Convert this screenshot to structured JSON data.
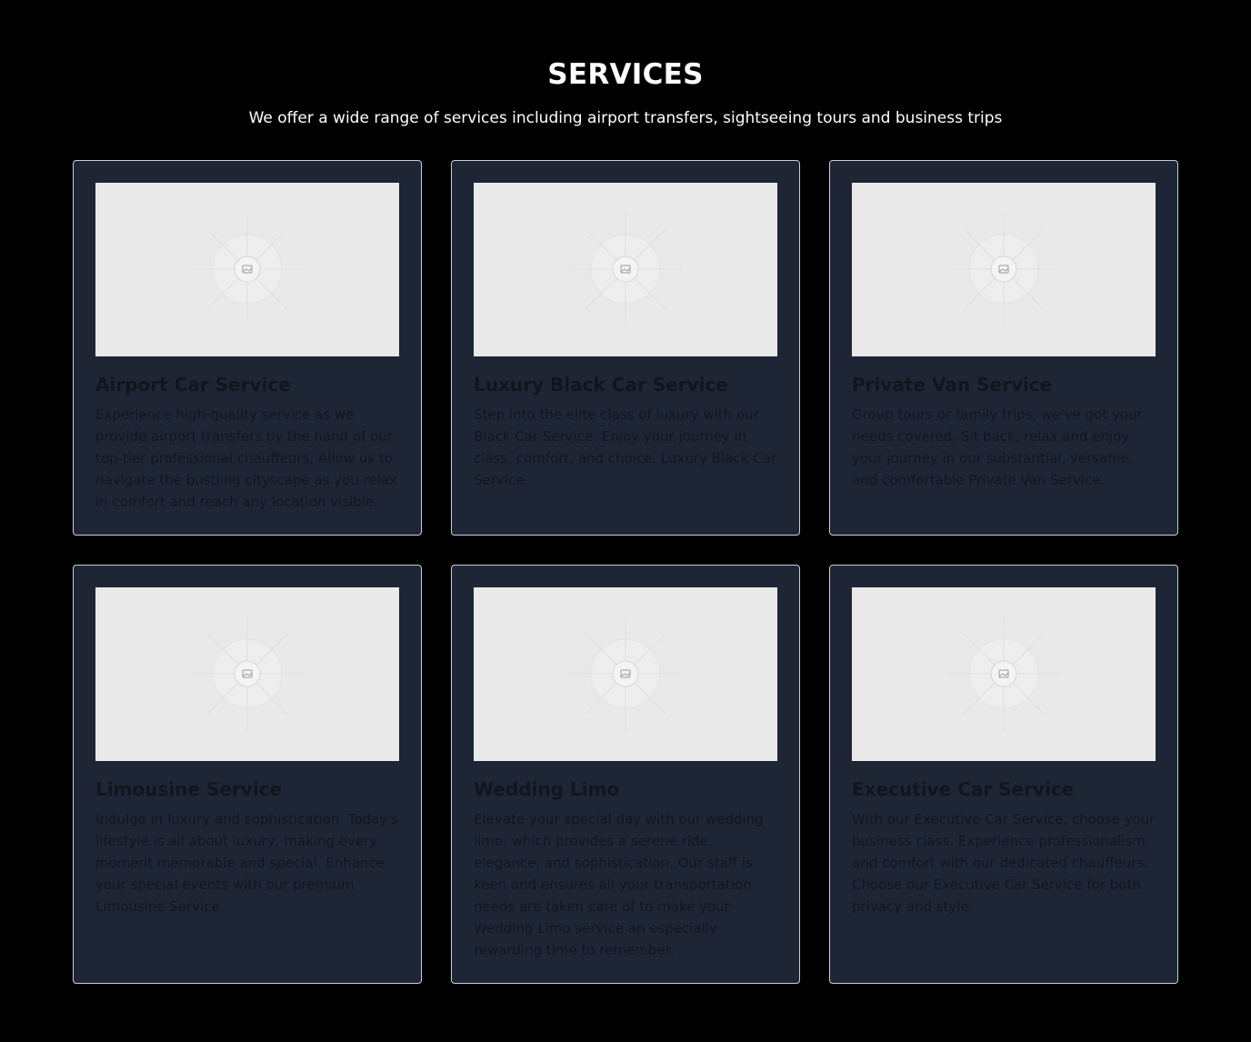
{
  "header": {
    "title": "SERVICES",
    "subtitle": "We offer a wide range of services including airport transfers, sightseeing tours and business trips"
  },
  "colors": {
    "page_background": "#000000",
    "card_background": "#1e2636",
    "card_border": "#c9ced8",
    "placeholder_background": "#e9e9e9",
    "heading_text": "#ffffff",
    "card_text": "#11151c"
  },
  "services": [
    {
      "title": "Airport Car Service",
      "description": "Experience high-quality service as we provide airport transfers by the hand of our top-tier professional chauffeurs. Allow us to navigate the bustling cityscape as you relax in comfort and reach any location visible.",
      "image_icon": "image-placeholder-icon"
    },
    {
      "title": "Luxury Black Car Service",
      "description": "Step into the elite class of luxury with our Black Car Service. Enjoy your journey in class, comfort, and choice. Luxury Black Car Service.",
      "image_icon": "image-placeholder-icon"
    },
    {
      "title": "Private Van Service",
      "description": "Group tours or family trips, we've got your needs covered. Sit back, relax and enjoy your journey in our substantial, versatile, and comfortable Private Van Service.",
      "image_icon": "image-placeholder-icon"
    },
    {
      "title": "Limousine Service",
      "description": "Indulge in luxury and sophistication. Today's lifestyle is all about luxury, making every moment memorable and special. Enhance your special events with our premium Limousine Service.",
      "image_icon": "image-placeholder-icon"
    },
    {
      "title": "Wedding Limo",
      "description": "Elevate your special day with our wedding limo, which provides a serene ride, elegance, and sophistication. Our staff is keen and ensures all your transportation needs are taken care of to make your Wedding Limo service an especially rewarding time to remember.",
      "image_icon": "image-placeholder-icon"
    },
    {
      "title": "Executive Car Service",
      "description": "With our Executive Car Service, choose your business class. Experience professionalism and comfort with our dedicated chauffeurs. Choose our Executive Car Service for both privacy and style.",
      "image_icon": "image-placeholder-icon"
    }
  ]
}
